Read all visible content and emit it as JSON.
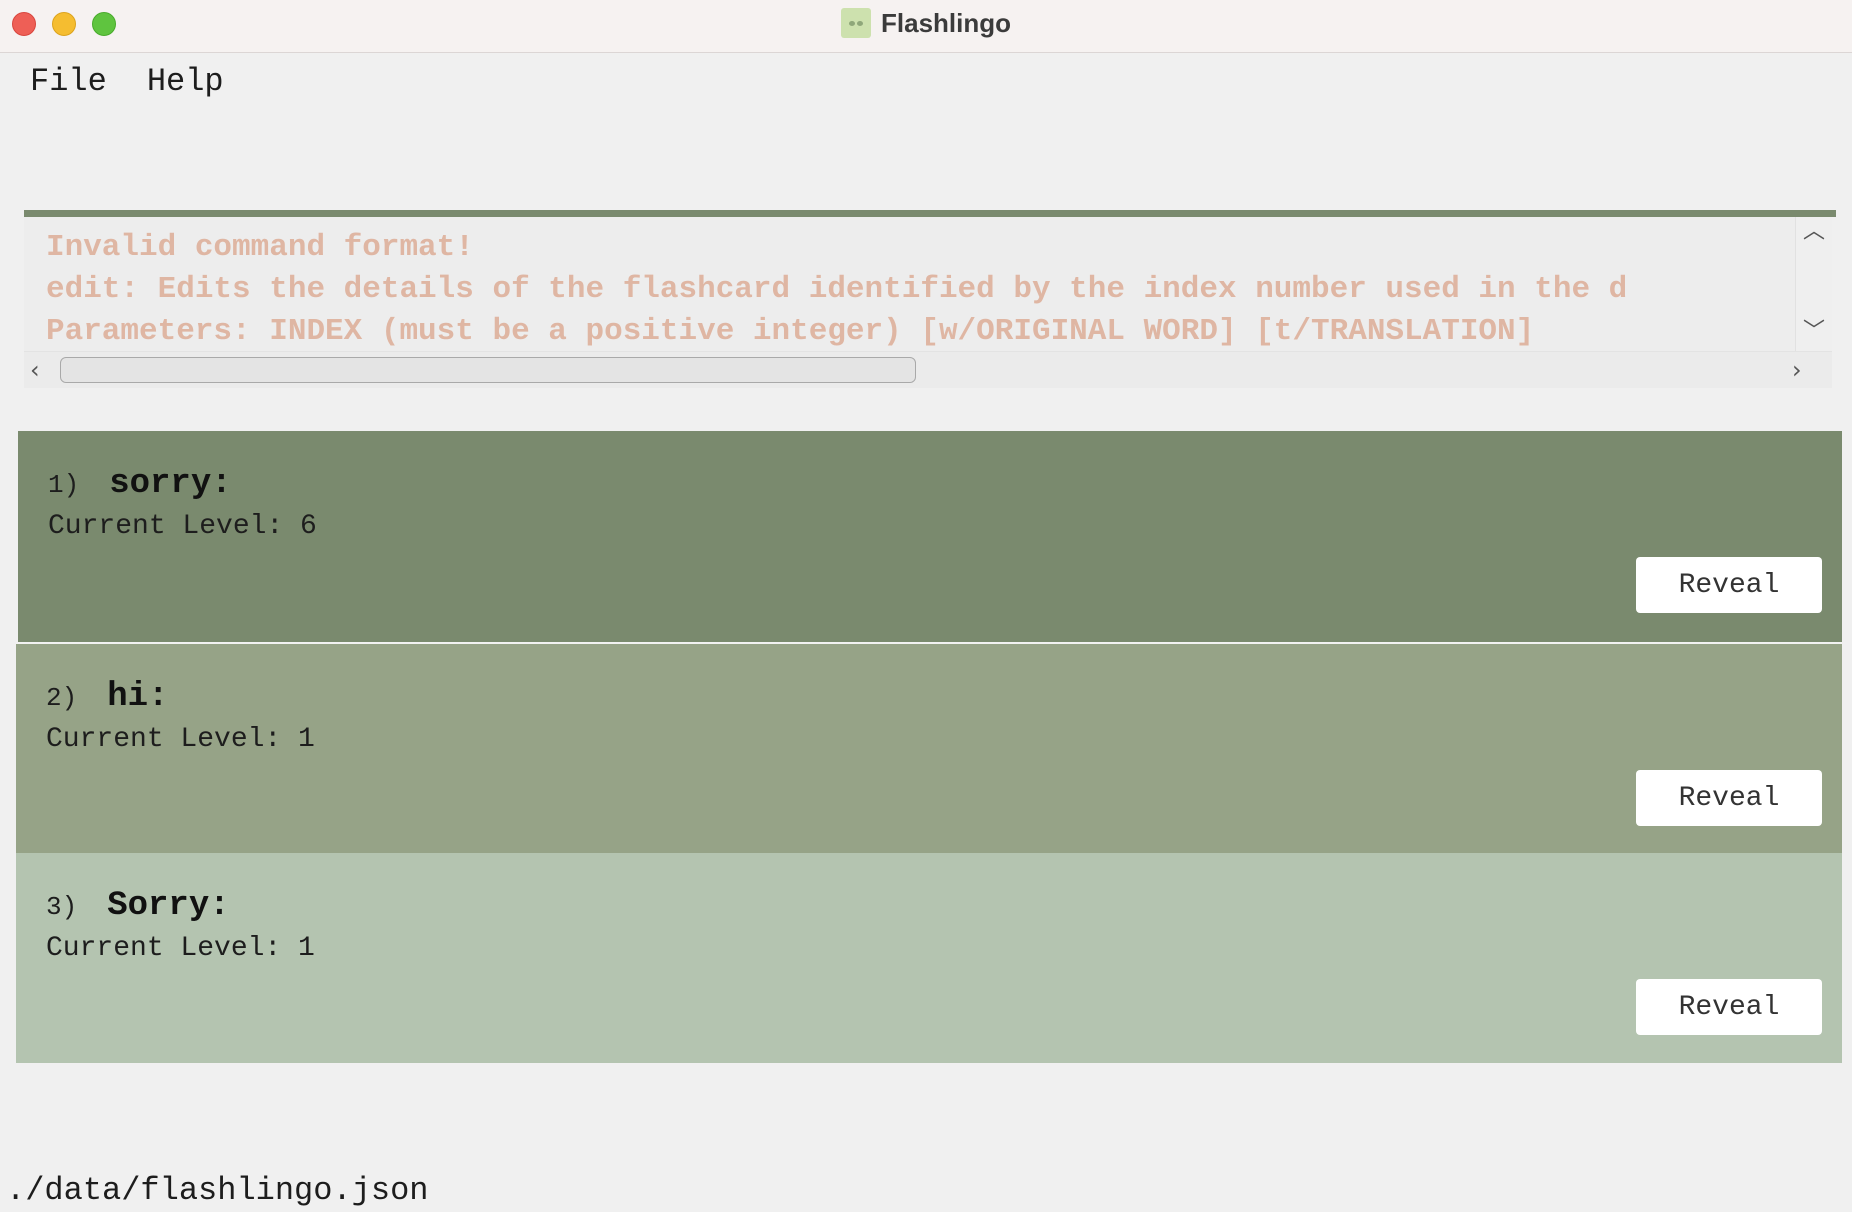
{
  "window": {
    "title": "Flashlingo",
    "icon": "flashlingo-app-icon"
  },
  "menu": {
    "items": [
      {
        "label": "File"
      },
      {
        "label": "Help"
      }
    ]
  },
  "result_display": {
    "lines": [
      "Invalid command format!",
      "edit: Edits the details of the flashcard identified by the index number used in the d",
      "Parameters: INDEX (must be a positive integer) [w/ORIGINAL WORD] [t/TRANSLATION]"
    ],
    "text_color": "#dfb6a3"
  },
  "flashcards": [
    {
      "index": "1)",
      "word": "sorry:",
      "level": "Current Level: 6",
      "button": "Reveal",
      "color": "#7a8a6e"
    },
    {
      "index": "2)",
      "word": "hi:",
      "level": "Current Level: 1",
      "button": "Reveal",
      "color": "#96a387"
    },
    {
      "index": "3)",
      "word": "Sorry:",
      "level": "Current Level: 1",
      "button": "Reveal",
      "color": "#b4c4b0"
    }
  ],
  "status_bar": {
    "path": "./data/flashlingo.json"
  }
}
